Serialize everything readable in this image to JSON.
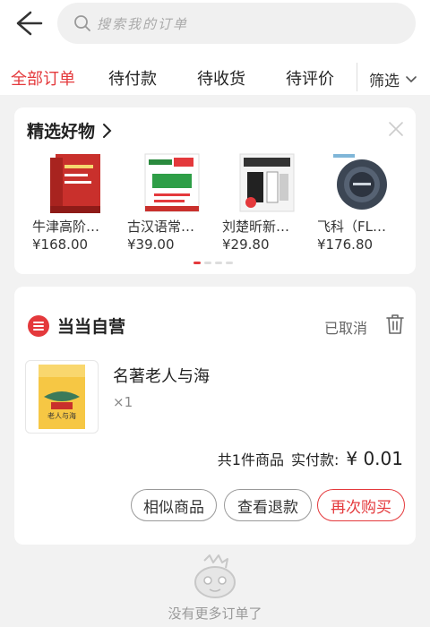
{
  "search": {
    "placeholder": "搜索我的订单"
  },
  "tabs": [
    {
      "label": "全部订单",
      "active": true
    },
    {
      "label": "待付款",
      "active": false
    },
    {
      "label": "待收货",
      "active": false
    },
    {
      "label": "待评价",
      "active": false
    }
  ],
  "filter": {
    "label": "筛选"
  },
  "promo": {
    "title": "精选好物",
    "products": [
      {
        "name": "牛津高阶…",
        "price": "¥168.00",
        "icon": "dictionary-cover-icon"
      },
      {
        "name": "古汉语常…",
        "price": "¥39.00",
        "icon": "dictionary-cover-icon"
      },
      {
        "name": "刘楚昕新…",
        "price": "¥29.80",
        "icon": "book-cover-icon"
      },
      {
        "name": "飞科（FL…",
        "price": "¥176.80",
        "icon": "air-purifier-icon"
      }
    ],
    "active_page": 1,
    "page_count": 4
  },
  "order": {
    "store": "当当自营",
    "status": "已取消",
    "item": {
      "name": "名著老人与海",
      "quantity": "×1",
      "cover_title": "老人与海"
    },
    "summary": {
      "count": "共1件商品",
      "paid_label": "实付款:",
      "paid_amount": "¥ 0.01"
    },
    "buttons": {
      "similar": "相似商品",
      "refund": "查看退款",
      "rebuy": "再次购买"
    }
  },
  "empty": {
    "message": "没有更多订单了"
  },
  "colors": {
    "accent": "#e4393c",
    "background": "#f2f2f2"
  }
}
